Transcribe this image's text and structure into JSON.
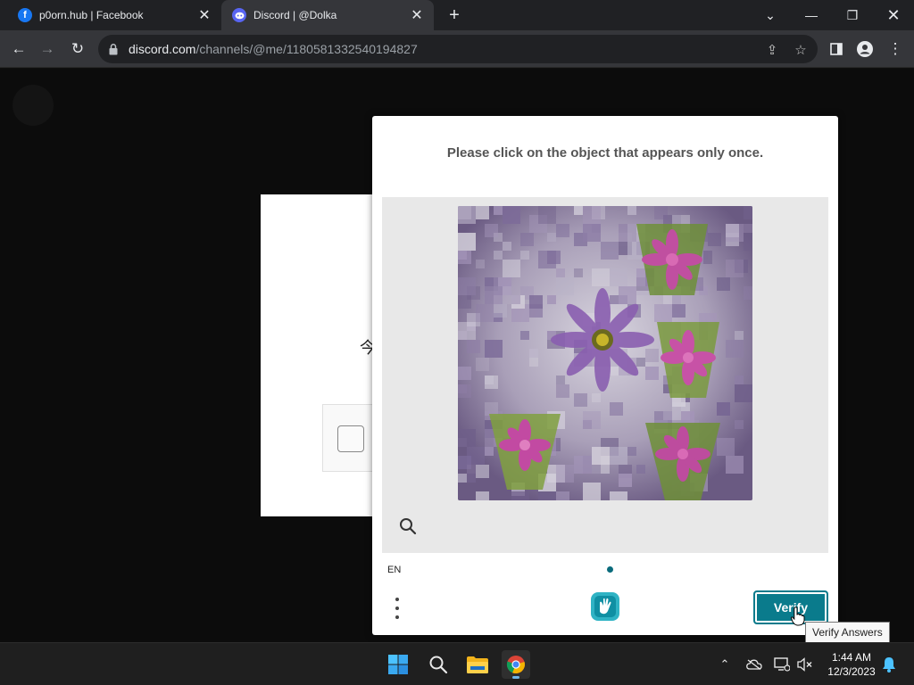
{
  "browser": {
    "tabs": [
      {
        "title": "p0orn.hub | Facebook",
        "icon": "facebook-icon"
      },
      {
        "title": "Discord | @Dolka",
        "icon": "discord-icon",
        "active": true
      }
    ],
    "address": {
      "host": "discord.com",
      "path": "/channels/@me/1180581332540194827"
    }
  },
  "background_card": {
    "glyph": "今"
  },
  "captcha": {
    "prompt": "Please click on the object that appears only once.",
    "language": "EN",
    "verify_label": "Verify",
    "tooltip": "Verify Answers",
    "accent_color": "#0a7b8c"
  },
  "taskbar": {
    "time": "1:44 AM",
    "date": "12/3/2023"
  }
}
